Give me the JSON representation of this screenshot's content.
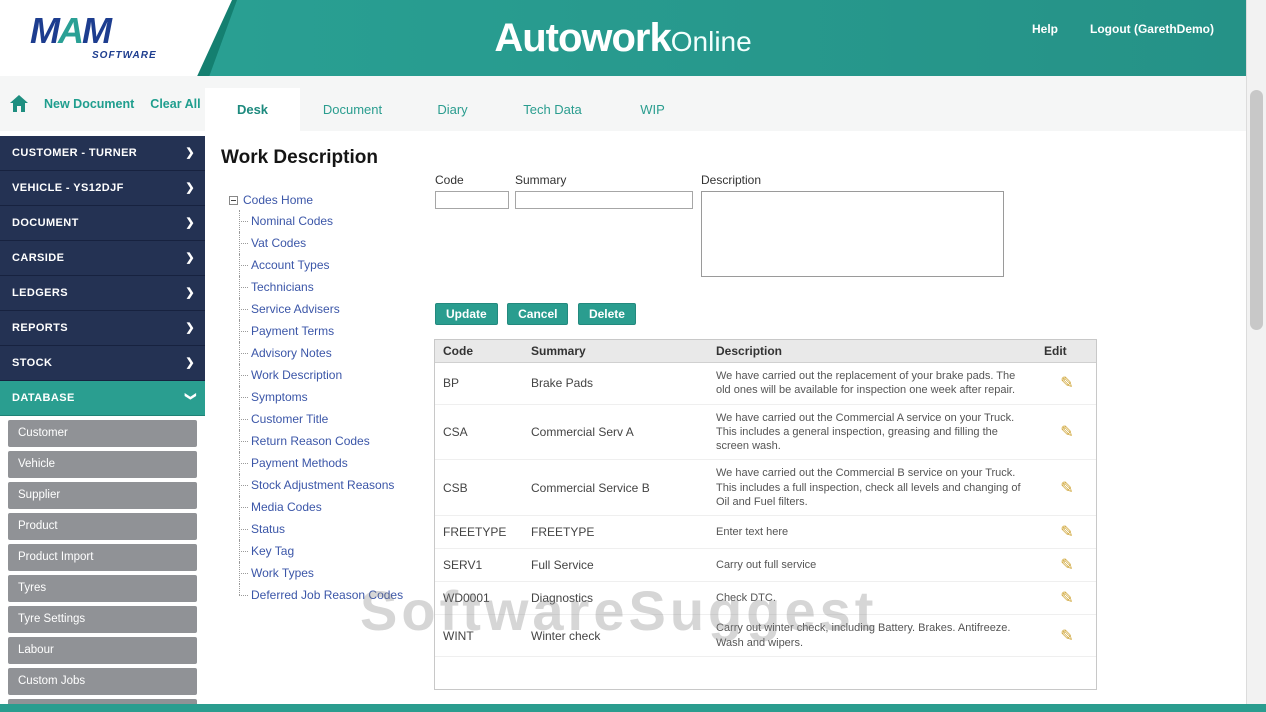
{
  "header": {
    "logo": {
      "m1": "M",
      "a": "A",
      "m2": "M",
      "software": "SOFTWARE"
    },
    "brand_bold": "Autowork",
    "brand_light": "Online",
    "help": "Help",
    "logout": "Logout (GarethDemo)"
  },
  "toolbar": {
    "new_document": "New Document",
    "clear_all": "Clear All"
  },
  "tabs": [
    {
      "label": "Desk",
      "active": true
    },
    {
      "label": "Document",
      "active": false
    },
    {
      "label": "Diary",
      "active": false
    },
    {
      "label": "Tech Data",
      "active": false
    },
    {
      "label": "WIP",
      "active": false
    }
  ],
  "sidebar": {
    "sections": [
      {
        "label": "CUSTOMER - TURNER"
      },
      {
        "label": "VEHICLE - YS12DJF"
      },
      {
        "label": "DOCUMENT"
      },
      {
        "label": "CARSIDE"
      },
      {
        "label": "LEDGERS"
      },
      {
        "label": "REPORTS"
      },
      {
        "label": "STOCK"
      },
      {
        "label": "DATABASE"
      }
    ],
    "database_items": [
      "Customer",
      "Vehicle",
      "Supplier",
      "Product",
      "Product Import",
      "Tyres",
      "Tyre Settings",
      "Labour",
      "Custom Jobs"
    ]
  },
  "main": {
    "title": "Work Description",
    "tree": {
      "root": "Codes Home",
      "items": [
        "Nominal Codes",
        "Vat Codes",
        "Account Types",
        "Technicians",
        "Service Advisers",
        "Payment Terms",
        "Advisory Notes",
        "Work Description",
        "Symptoms",
        "Customer Title",
        "Return Reason Codes",
        "Payment Methods",
        "Stock Adjustment Reasons",
        "Media Codes",
        "Status",
        "Key Tag",
        "Work Types",
        "Deferred Job Reason Codes"
      ]
    },
    "form": {
      "code_label": "Code",
      "summary_label": "Summary",
      "description_label": "Description",
      "code_value": "",
      "summary_value": "",
      "description_value": "",
      "update_label": "Update",
      "cancel_label": "Cancel",
      "delete_label": "Delete"
    },
    "table": {
      "headers": {
        "code": "Code",
        "summary": "Summary",
        "description": "Description",
        "edit": "Edit"
      },
      "rows": [
        {
          "code": "BP",
          "summary": "Brake Pads",
          "description": "We have carried out the replacement of your brake pads. The old ones will be available for inspection one week after repair."
        },
        {
          "code": "CSA",
          "summary": "Commercial Serv A",
          "description": "We have carried out the Commercial A service on your Truck. This includes a general inspection, greasing and filling the screen wash."
        },
        {
          "code": "CSB",
          "summary": "Commercial Service B",
          "description": "We have carried out the Commercial B service on your Truck. This includes a full inspection, check all levels and changing of Oil and Fuel filters."
        },
        {
          "code": "FREETYPE",
          "summary": "FREETYPE",
          "description": "Enter text here"
        },
        {
          "code": "SERV1",
          "summary": "Full Service",
          "description": "Carry out full service"
        },
        {
          "code": "WD0001",
          "summary": "Diagnostics",
          "description": "Check DTC."
        },
        {
          "code": "WINT",
          "summary": "Winter check",
          "description": "Carry out winter check, including Battery. Brakes. Antifreeze. Wash and wipers."
        }
      ]
    },
    "watermark": "SoftwareSuggest"
  },
  "colors": {
    "accent_teal": "#2a9d8f",
    "sidebar_navy": "#243253",
    "sub_item_gray": "#909296",
    "pencil_orange": "#cda12e"
  }
}
